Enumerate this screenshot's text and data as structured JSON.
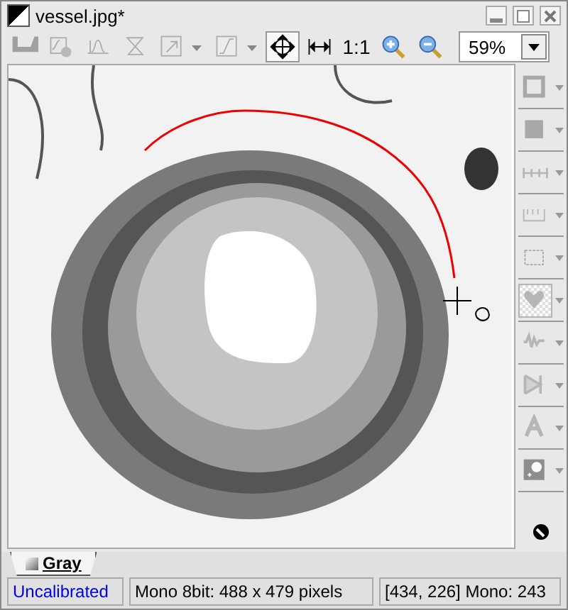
{
  "window": {
    "title": "vessel.jpg*"
  },
  "toolbar": {
    "items": [
      {
        "kind": "levels",
        "disabled": true,
        "selected": false
      },
      {
        "kind": "curve",
        "disabled": true,
        "selected": false
      },
      {
        "kind": "peak",
        "disabled": true,
        "selected": false
      },
      {
        "kind": "hourglass",
        "disabled": true,
        "selected": false
      },
      {
        "kind": "arrow",
        "disabled": true,
        "selected": false
      },
      {
        "kind": "gamma",
        "disabled": true,
        "selected": false
      },
      {
        "kind": "pan",
        "disabled": false,
        "selected": true
      },
      {
        "kind": "fit-width",
        "disabled": false,
        "selected": false
      },
      {
        "kind": "actual-size",
        "label": "1:1",
        "disabled": false,
        "selected": false
      },
      {
        "kind": "zoom-in",
        "disabled": false,
        "selected": false
      },
      {
        "kind": "zoom-out",
        "disabled": false,
        "selected": false
      }
    ],
    "zoom": {
      "value": "59%"
    }
  },
  "side_toolbar": {
    "items": [
      {
        "kind": "rect",
        "disabled": true,
        "selected": false
      },
      {
        "kind": "filled-rect",
        "disabled": true,
        "selected": false
      },
      {
        "kind": "line",
        "disabled": true,
        "selected": false
      },
      {
        "kind": "ruler",
        "disabled": true,
        "selected": false
      },
      {
        "kind": "crop",
        "disabled": true,
        "selected": false
      },
      {
        "kind": "heart",
        "disabled": true,
        "selected": true
      },
      {
        "kind": "wave",
        "disabled": true,
        "selected": false
      },
      {
        "kind": "flip",
        "disabled": true,
        "selected": false
      },
      {
        "kind": "text",
        "disabled": true,
        "selected": false
      },
      {
        "kind": "spot",
        "disabled": true,
        "selected": false
      }
    ]
  },
  "tabs": [
    {
      "label": "Gray",
      "selected": true
    }
  ],
  "status_bar": {
    "calibration": "Uncalibrated",
    "image_info": "Mono 8bit: 488 x 479 pixels",
    "pixel_info": "[434, 226] Mono: 243"
  }
}
